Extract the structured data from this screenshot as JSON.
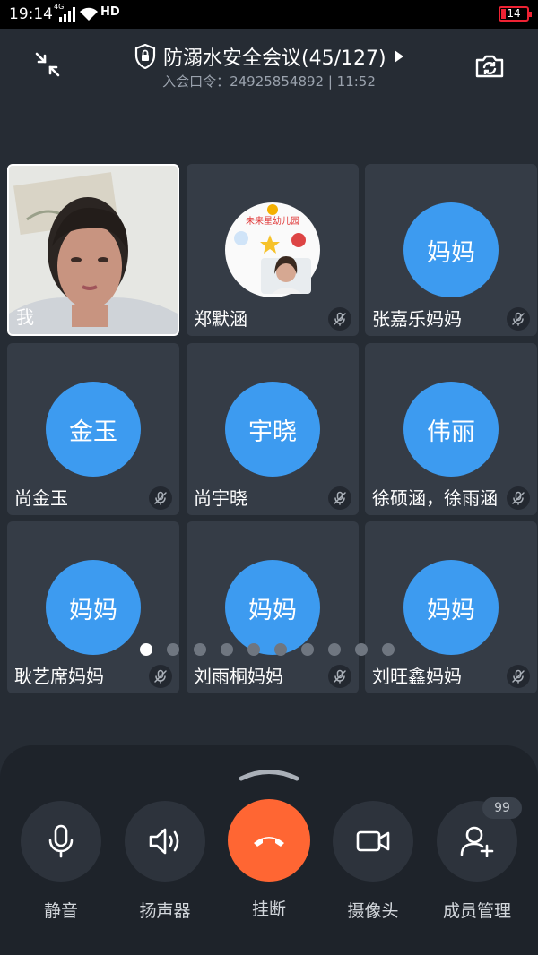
{
  "status_bar": {
    "time": "19:14",
    "network": "4G",
    "hd": "HD",
    "battery": "14",
    "battery_color": "#e22a2a"
  },
  "meeting": {
    "title": "防溺水安全会议(45/127)",
    "subtitle": "入会口令：24925854892 | 11:52"
  },
  "participants": [
    {
      "name": "我",
      "type": "video",
      "muted": false
    },
    {
      "name": "郑默涵",
      "type": "image",
      "logo_text": "未来星幼儿园",
      "muted": true
    },
    {
      "name": "张嘉乐妈妈",
      "avatar": "妈妈",
      "muted": true
    },
    {
      "name": "尚金玉",
      "avatar": "金玉",
      "muted": true
    },
    {
      "name": "尚宇晓",
      "avatar": "宇晓",
      "muted": true
    },
    {
      "name": "徐硕涵，徐雨涵",
      "avatar": "伟丽",
      "muted": true
    },
    {
      "name": "耿艺席妈妈",
      "avatar": "妈妈",
      "muted": true
    },
    {
      "name": "刘雨桐妈妈",
      "avatar": "妈妈",
      "muted": true
    },
    {
      "name": "刘旺鑫妈妈",
      "avatar": "妈妈",
      "muted": true
    }
  ],
  "pagination": {
    "pages": 10,
    "current": 1
  },
  "controls": {
    "mute": "静音",
    "speaker": "扬声器",
    "hangup": "挂断",
    "camera": "摄像头",
    "members": "成员管理",
    "members_badge": "99"
  },
  "colors": {
    "avatar": "#3d9bf0",
    "hangup": "#ff6633",
    "background": "#262c34"
  }
}
